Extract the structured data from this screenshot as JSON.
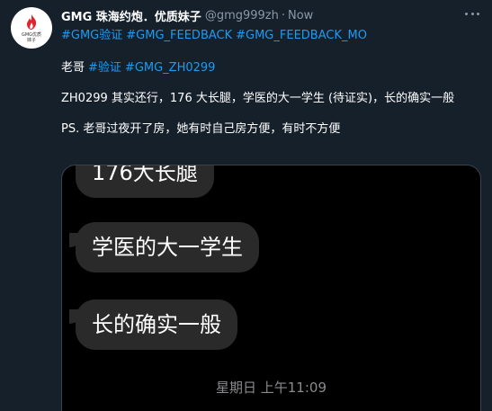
{
  "tweet": {
    "display_name": "GMG 珠海约炮．优质妹子",
    "handle": "@gmg999zh",
    "dot": "·",
    "time": "Now",
    "avatar_text_line1": "GMG优质",
    "avatar_text_line2": "妹子",
    "tags_line": [
      "#GMG验证",
      "#GMG_FEEDBACK",
      "#GMG_FEEDBACK_MO"
    ],
    "line2_plain": "老哥",
    "line2_tags": [
      "#验证",
      "#GMG_ZH0299"
    ],
    "line3": "ZH0299 其实还行，176 大长腿，学医的大一学生 (待证实)，长的确实一般",
    "line4": "PS. 老哥过夜开了房，她有时自己房方便，有时不方便"
  },
  "media": {
    "bubbles": [
      "176大长腿",
      "学医的大一学生",
      "长的确实一般"
    ],
    "timestamp": "星期日 上午11:09"
  },
  "colors": {
    "background": "#15202b",
    "link": "#1d9bf0",
    "muted": "#8b98a5",
    "bubble": "#2a2a2b"
  }
}
